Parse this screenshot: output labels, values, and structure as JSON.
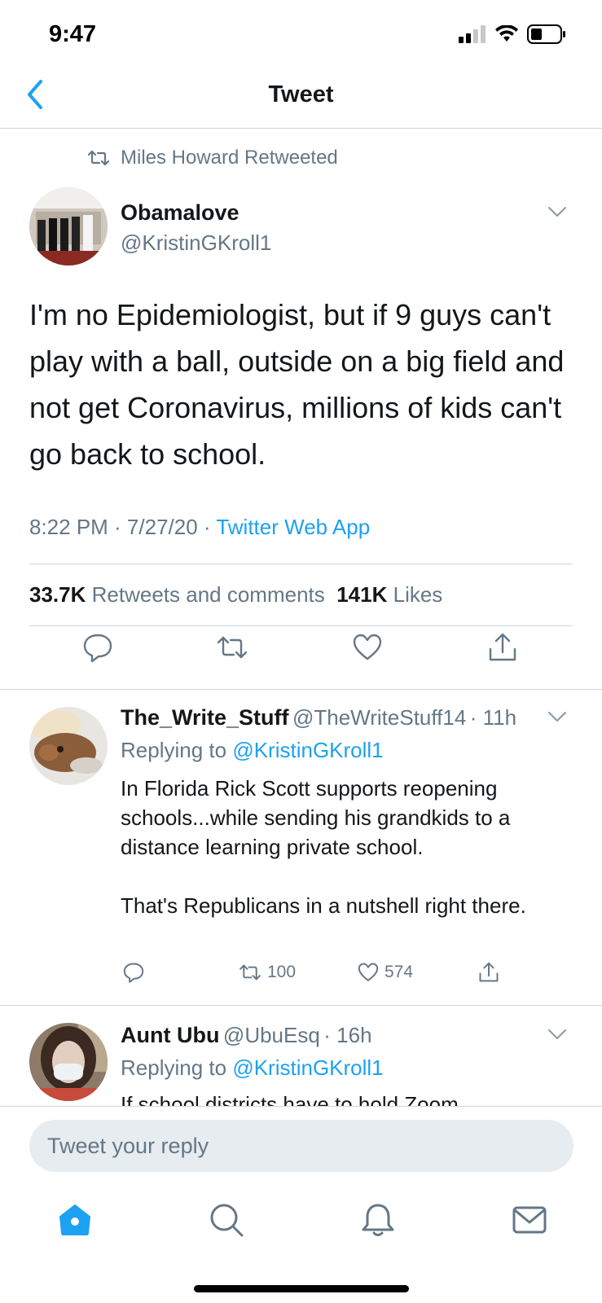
{
  "status_bar": {
    "time": "9:47"
  },
  "nav": {
    "title": "Tweet"
  },
  "retweet_line": "Miles Howard Retweeted",
  "main_tweet": {
    "author_name": "Obamalove",
    "author_handle": "@KristinGKroll1",
    "text": "I'm no Epidemiologist, but if 9 guys can't play with a ball, outside on a big field and not get Coronavirus, millions of kids can't go back to school.",
    "time": "8:22 PM · 7/27/20 · ",
    "source": "Twitter Web App",
    "retweets_count": "33.7K",
    "retweets_label": "Retweets and comments",
    "likes_count": "141K",
    "likes_label": "Likes"
  },
  "replies": [
    {
      "name": "The_Write_Stuff",
      "handle": "@TheWriteStuff14",
      "time": "· 11h",
      "replying_prefix": "Replying to ",
      "replying_to": "@KristinGKroll1",
      "text": "In Florida Rick Scott supports reopening schools...while sending his grandkids to a distance learning private school.\n\nThat's Republicans in a nutshell right there.",
      "retweets": "100",
      "likes": "574"
    },
    {
      "name": "Aunt Ubu",
      "handle": "@UbuEsq",
      "time": "· 16h",
      "replying_prefix": "Replying to ",
      "replying_to": "@KristinGKroll1",
      "text": "If school districts have to hold Zoom"
    }
  ],
  "reply_input": {
    "placeholder": "Tweet your reply"
  },
  "tab_bar": [
    "home-icon",
    "search-icon",
    "bell-icon",
    "mail-icon"
  ],
  "colors": {
    "accent": "#1da1f2",
    "secondary_text": "#657786",
    "divider": "#ccd6dd"
  }
}
